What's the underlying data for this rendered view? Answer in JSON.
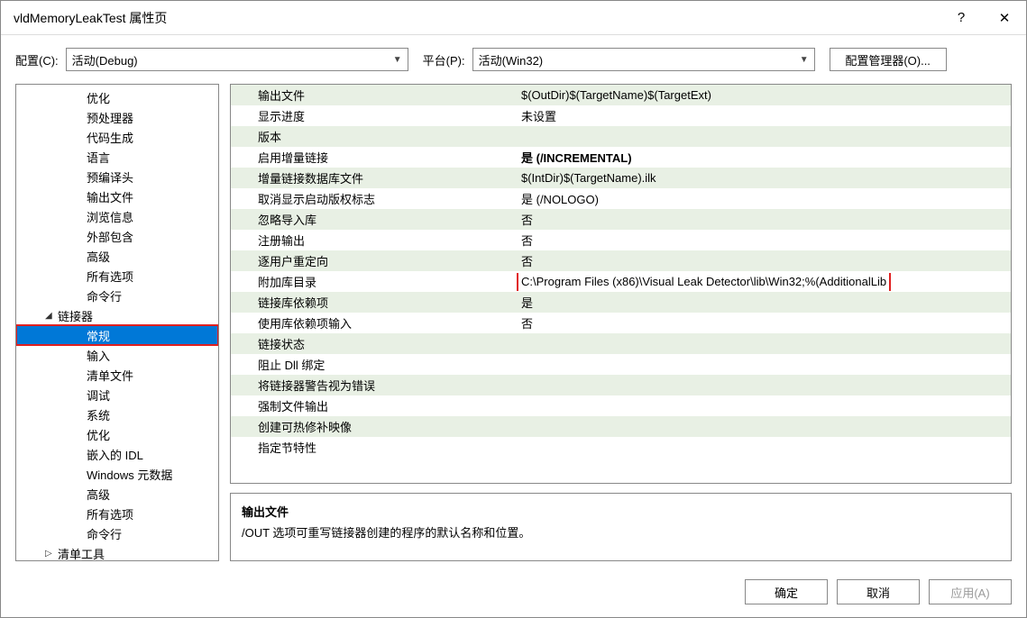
{
  "title": "vldMemoryLeakTest 属性页",
  "toolbar": {
    "config_label": "配置(C):",
    "config_value": "活动(Debug)",
    "platform_label": "平台(P):",
    "platform_value": "活动(Win32)",
    "config_manager": "配置管理器(O)..."
  },
  "tree": [
    {
      "label": "优化",
      "level": 2
    },
    {
      "label": "预处理器",
      "level": 2
    },
    {
      "label": "代码生成",
      "level": 2
    },
    {
      "label": "语言",
      "level": 2
    },
    {
      "label": "预编译头",
      "level": 2
    },
    {
      "label": "输出文件",
      "level": 2
    },
    {
      "label": "浏览信息",
      "level": 2
    },
    {
      "label": "外部包含",
      "level": 2
    },
    {
      "label": "高级",
      "level": 2
    },
    {
      "label": "所有选项",
      "level": 2
    },
    {
      "label": "命令行",
      "level": 2
    },
    {
      "label": "链接器",
      "level": 1,
      "expand": "down"
    },
    {
      "label": "常规",
      "level": 2,
      "selected": true,
      "redbox": true
    },
    {
      "label": "输入",
      "level": 2
    },
    {
      "label": "清单文件",
      "level": 2
    },
    {
      "label": "调试",
      "level": 2
    },
    {
      "label": "系统",
      "level": 2
    },
    {
      "label": "优化",
      "level": 2
    },
    {
      "label": "嵌入的 IDL",
      "level": 2
    },
    {
      "label": "Windows 元数据",
      "level": 2
    },
    {
      "label": "高级",
      "level": 2
    },
    {
      "label": "所有选项",
      "level": 2
    },
    {
      "label": "命令行",
      "level": 2
    },
    {
      "label": "清单工具",
      "level": 1,
      "expand": "right"
    }
  ],
  "props": [
    {
      "label": "输出文件",
      "value": "$(OutDir)$(TargetName)$(TargetExt)"
    },
    {
      "label": "显示进度",
      "value": "未设置"
    },
    {
      "label": "版本",
      "value": ""
    },
    {
      "label": "启用增量链接",
      "value": "是 (/INCREMENTAL)",
      "bold": true
    },
    {
      "label": "增量链接数据库文件",
      "value": "$(IntDir)$(TargetName).ilk"
    },
    {
      "label": "取消显示启动版权标志",
      "value": "是 (/NOLOGO)"
    },
    {
      "label": "忽略导入库",
      "value": "否"
    },
    {
      "label": "注册输出",
      "value": "否"
    },
    {
      "label": "逐用户重定向",
      "value": "否"
    },
    {
      "label": "附加库目录",
      "value": "C:\\Program Files (x86)\\Visual Leak Detector\\lib\\Win32;%(AdditionalLib",
      "redbox": true
    },
    {
      "label": "链接库依赖项",
      "value": "是"
    },
    {
      "label": "使用库依赖项输入",
      "value": "否"
    },
    {
      "label": "链接状态",
      "value": ""
    },
    {
      "label": "阻止 Dll 绑定",
      "value": ""
    },
    {
      "label": "将链接器警告视为错误",
      "value": ""
    },
    {
      "label": "强制文件输出",
      "value": ""
    },
    {
      "label": "创建可热修补映像",
      "value": ""
    },
    {
      "label": "指定节特性",
      "value": ""
    }
  ],
  "desc": {
    "title": "输出文件",
    "text": "/OUT 选项可重写链接器创建的程序的默认名称和位置。"
  },
  "footer": {
    "ok": "确定",
    "cancel": "取消",
    "apply": "应用(A)"
  }
}
